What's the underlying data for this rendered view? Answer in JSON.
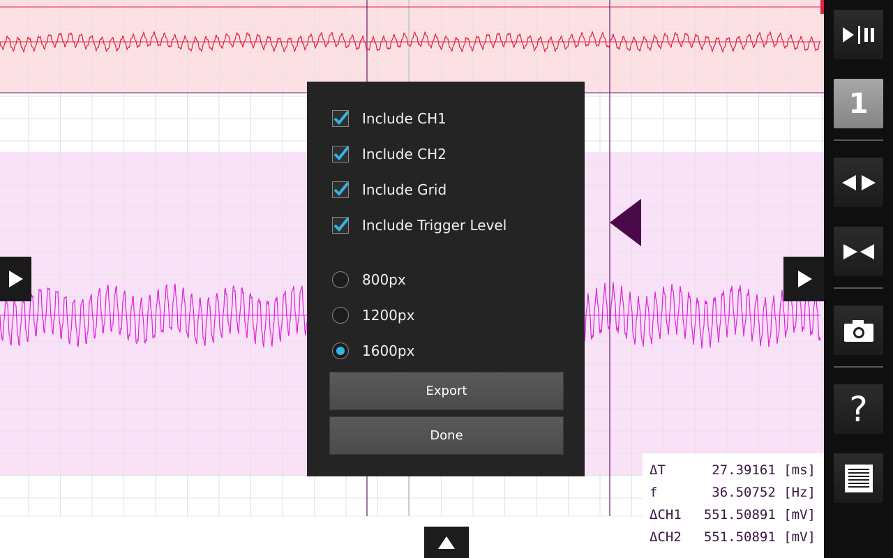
{
  "toolbar": {
    "run_pause_icon": "play-pause-icon",
    "channel_number": "1",
    "expand_icon": "arrows-outward-icon",
    "collapse_icon": "arrows-inward-icon",
    "camera_icon": "camera-icon",
    "help_glyph": "?",
    "menu_icon": "list-icon"
  },
  "colors": {
    "ch1_trace": "#e0203f",
    "ch1_band": "#fde0e4",
    "ch2_trace": "#e020e0",
    "ch2_band": "#f9e1f7",
    "cursor_line": "#6a1a6a",
    "accent": "#33b5e5",
    "dialog_bg": "#242424",
    "toolbar_bg": "#0f0f0f"
  },
  "export_dialog": {
    "options": [
      {
        "label": "Include CH1",
        "checked": true
      },
      {
        "label": "Include CH2",
        "checked": true
      },
      {
        "label": "Include Grid",
        "checked": true
      },
      {
        "label": "Include Trigger Level",
        "checked": true
      }
    ],
    "resolutions": [
      {
        "label": "800px",
        "selected": false
      },
      {
        "label": "1200px",
        "selected": false
      },
      {
        "label": "1600px",
        "selected": true
      }
    ],
    "export_label": "Export",
    "done_label": "Done"
  },
  "readout": [
    {
      "label": "ΔT",
      "value": "27.39161 [ms]"
    },
    {
      "label": "f",
      "value": "36.50752 [Hz]"
    },
    {
      "label": "ΔCH1",
      "value": "551.50891 [mV]"
    },
    {
      "label": "ΔCH2",
      "value": "551.50891 [mV]"
    }
  ]
}
